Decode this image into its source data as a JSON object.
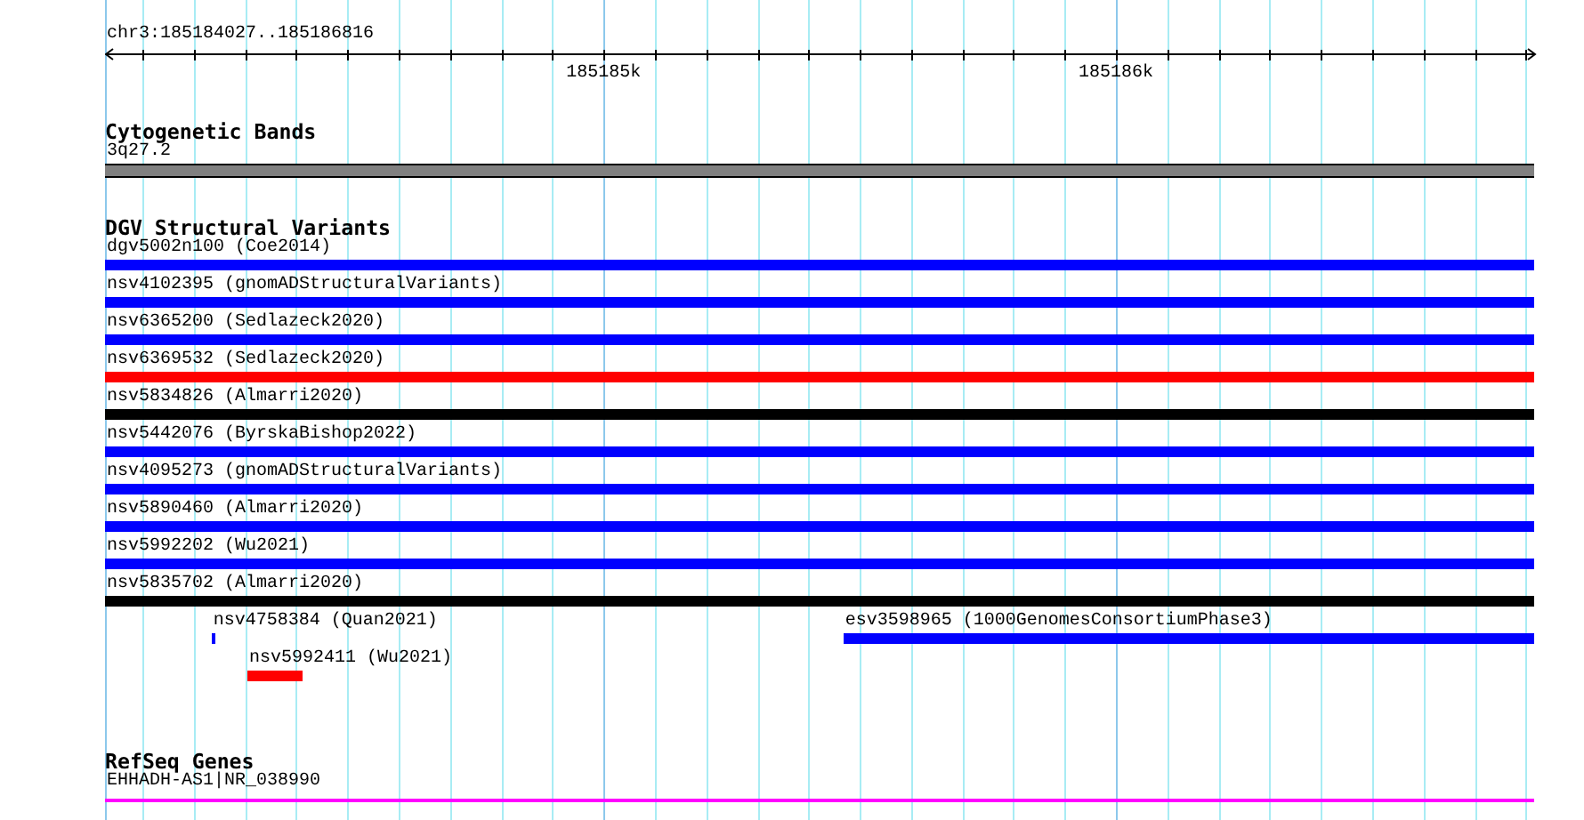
{
  "ruler": {
    "label": "chr3:185184027..185186816",
    "ticks": [
      {
        "label": "185185k"
      },
      {
        "label": "185186k"
      }
    ]
  },
  "cytogenetic_bands": {
    "title": "Cytogenetic Bands",
    "bands": [
      {
        "label": "3q27.2"
      }
    ]
  },
  "dgv": {
    "title": "DGV Structural Variants",
    "lanes": [
      [
        {
          "label": "dgv5002n100 (Coe2014)",
          "color": "#0000ff"
        }
      ],
      [
        {
          "label": "nsv4102395 (gnomADStructuralVariants)",
          "color": "#0000ff"
        }
      ],
      [
        {
          "label": "nsv6365200 (Sedlazeck2020)",
          "color": "#0000ff"
        }
      ],
      [
        {
          "label": "nsv6369532 (Sedlazeck2020)",
          "color": "#ff0000"
        }
      ],
      [
        {
          "label": "nsv5834826 (Almarri2020)",
          "color": "#000000"
        }
      ],
      [
        {
          "label": "nsv5442076 (ByrskaBishop2022)",
          "color": "#0000ff"
        }
      ],
      [
        {
          "label": "nsv4095273 (gnomADStructuralVariants)",
          "color": "#0000ff"
        }
      ],
      [
        {
          "label": "nsv5890460 (Almarri2020)",
          "color": "#0000ff"
        }
      ],
      [
        {
          "label": "nsv5992202 (Wu2021)",
          "color": "#0000ff"
        }
      ],
      [
        {
          "label": "nsv5835702 (Almarri2020)",
          "color": "#000000"
        }
      ],
      [
        {
          "label": "nsv4758384 (Quan2021)",
          "color": "#0000ff"
        },
        {
          "label": "esv3598965 (1000GenomesConsortiumPhase3)",
          "color": "#0000ff"
        }
      ],
      [
        {
          "label": "nsv5992411 (Wu2021)",
          "color": "#ff0000"
        }
      ]
    ]
  },
  "refseq": {
    "title": "RefSeq Genes",
    "genes": [
      {
        "label": "EHHADH-AS1|NR_038990"
      }
    ]
  }
}
